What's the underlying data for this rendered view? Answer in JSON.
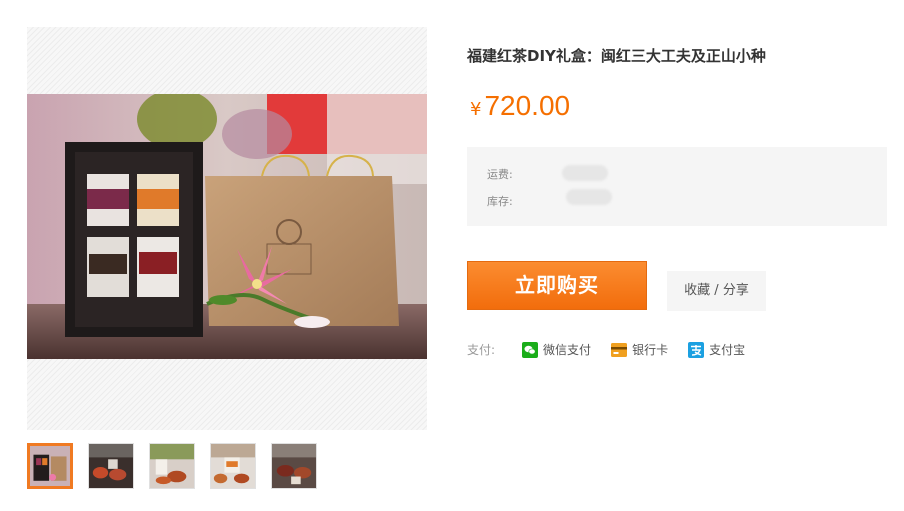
{
  "product": {
    "title": "福建红茶DIY礼盒：闽红三大工夫及正山小种",
    "price_currency": "¥",
    "price_value": "720.00"
  },
  "info": {
    "shipping_label": "运费:",
    "stock_label": "库存:"
  },
  "actions": {
    "buy_label": "立即购买",
    "favorite_share_label": "收藏 / 分享"
  },
  "payment": {
    "label": "支付:",
    "methods": [
      {
        "name": "微信支付",
        "icon": "wechat-pay-icon"
      },
      {
        "name": "银行卡",
        "icon": "bank-card-icon"
      },
      {
        "name": "支付宝",
        "icon": "alipay-icon"
      }
    ]
  },
  "gallery": {
    "thumbnail_count": 5,
    "active_index": 0
  },
  "colors": {
    "accent": "#f56f00",
    "buy_button": "#f47b20",
    "info_bg": "#f5f5f5",
    "wechat": "#1aad19",
    "bank": "#f0a020",
    "alipay": "#1ba0e1"
  }
}
